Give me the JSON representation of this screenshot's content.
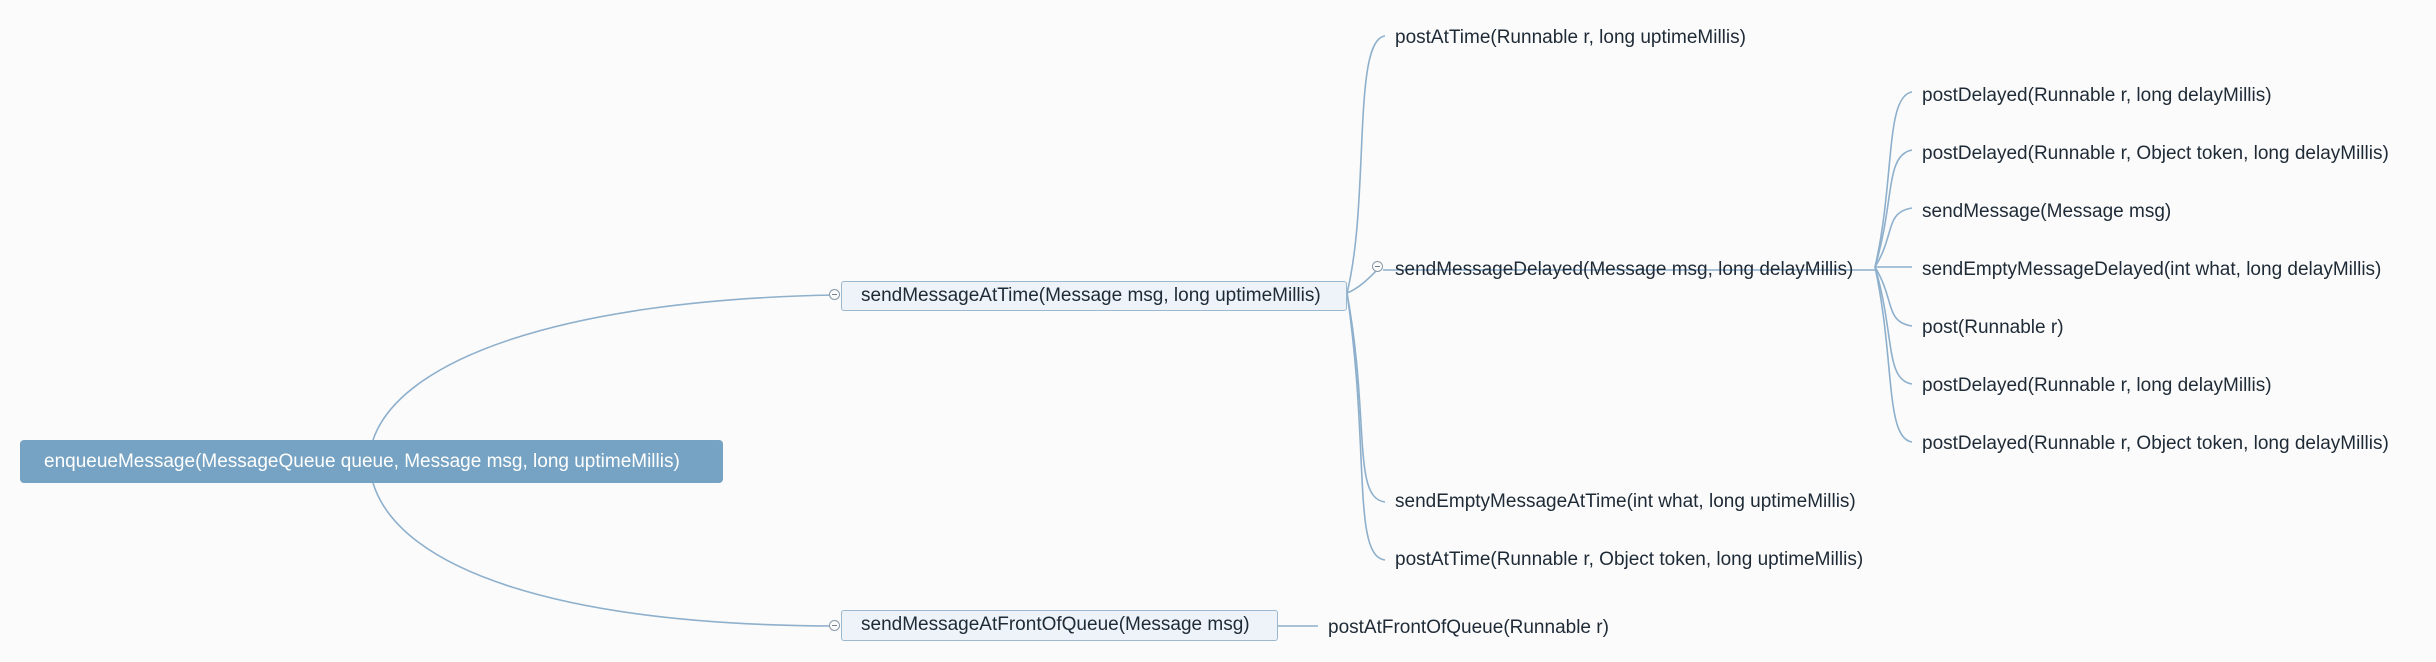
{
  "root": {
    "label": "enqueueMessage(MessageQueue queue, Message msg, long uptimeMillis)"
  },
  "branch_time": {
    "label": "sendMessageAtTime(Message msg, long uptimeMillis)",
    "children": {
      "post_at_time": "postAtTime(Runnable r, long uptimeMillis)",
      "send_message_delayed": {
        "label": "sendMessageDelayed(Message msg, long delayMillis)",
        "children": [
          "postDelayed(Runnable r, long delayMillis)",
          "postDelayed(Runnable r, Object token, long delayMillis)",
          "sendMessage(Message msg)",
          "sendEmptyMessageDelayed(int what, long delayMillis)",
          "post(Runnable r)",
          "postDelayed(Runnable r, long delayMillis)",
          "postDelayed(Runnable r, Object token, long delayMillis)"
        ]
      },
      "send_empty_message_at_time": "sendEmptyMessageAtTime(int what, long uptimeMillis)",
      "post_at_time_token": "postAtTime(Runnable r, Object token, long uptimeMillis)"
    }
  },
  "branch_front": {
    "label": "sendMessageAtFrontOfQueue(Message msg)",
    "children": {
      "post_at_front": "postAtFrontOfQueue(Runnable r)"
    }
  },
  "colors": {
    "root_fill": "#76a3c3",
    "box_fill": "#edf3f8",
    "box_border": "#9ab8d0",
    "connector": "#8eb0cc"
  }
}
